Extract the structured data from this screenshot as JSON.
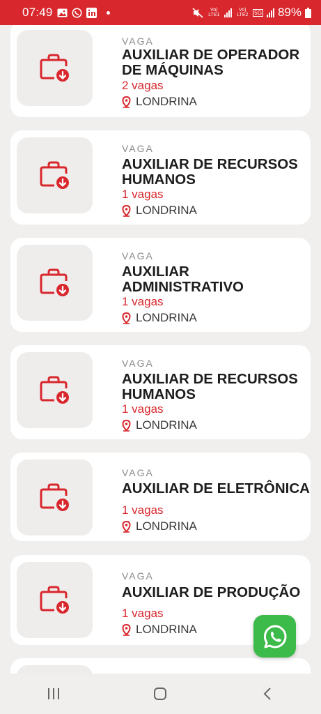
{
  "status_bar": {
    "time": "07:49",
    "battery": "89%",
    "sim1_label": "Vo) LTE1",
    "sim2_label": "Vo) LTE2",
    "network": "5G"
  },
  "jobs": [
    {
      "label": "VAGA",
      "title": "AUXILIAR DE OPERADOR DE MÁQUINAS",
      "count": "2 vagas",
      "location": "LONDRINA"
    },
    {
      "label": "VAGA",
      "title": "AUXILIAR DE RECURSOS HUMANOS",
      "count": "1 vagas",
      "location": "LONDRINA"
    },
    {
      "label": "VAGA",
      "title": "AUXILIAR ADMINISTRATIVO",
      "count": "1 vagas",
      "location": "LONDRINA"
    },
    {
      "label": "VAGA",
      "title": "AUXILIAR DE RECURSOS HUMANOS",
      "count": "1 vagas",
      "location": "LONDRINA"
    },
    {
      "label": "VAGA",
      "title": "AUXILIAR DE ELETRÔNICA",
      "count": "1 vagas",
      "location": "LONDRINA"
    },
    {
      "label": "VAGA",
      "title": "AUXILIAR DE PRODUÇÃO",
      "count": "1 vagas",
      "location": "LONDRINA"
    }
  ],
  "colors": {
    "brand": "#d8272d",
    "whatsapp": "#3dbb4a",
    "background": "#f1efee"
  },
  "icons": {
    "job": "briefcase-download-icon",
    "location": "location-pin-icon",
    "whatsapp": "whatsapp-icon"
  }
}
